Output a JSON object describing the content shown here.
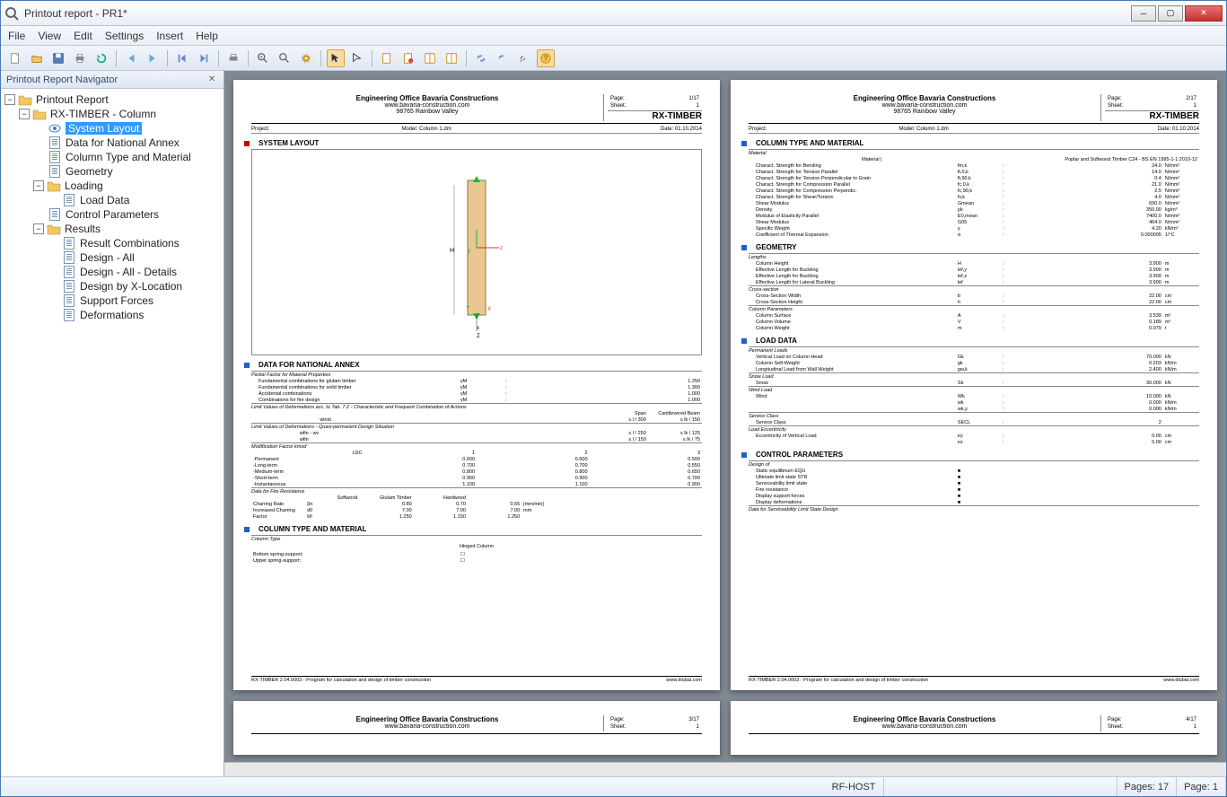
{
  "window": {
    "title": "Printout report - PR1*"
  },
  "menu": {
    "file": "File",
    "view": "View",
    "edit": "Edit",
    "settings": "Settings",
    "insert": "Insert",
    "help": "Help"
  },
  "navigator": {
    "title": "Printout Report Navigator",
    "tree": {
      "root": "Printout Report",
      "module": "RX-TIMBER - Column",
      "items": {
        "system_layout": "System Layout",
        "data_nat_annex": "Data for National Annex",
        "col_type_mat": "Column Type and Material",
        "geometry": "Geometry",
        "loading": "Loading",
        "load_data": "Load Data",
        "control_params": "Control Parameters",
        "results": "Results",
        "result_comb": "Result Combinations",
        "design_all": "Design - All",
        "design_all_details": "Design - All - Details",
        "design_by_x": "Design by X-Location",
        "support_forces": "Support Forces",
        "deformations": "Deformations"
      }
    }
  },
  "report": {
    "company": "Engineering Office Bavaria Constructions",
    "website": "www.bavaria-construction.com",
    "address": "98765 Rainbow Valley",
    "brand": "RX-TIMBER",
    "project_label": "Project:",
    "model_label": "Model:",
    "model_value": "Column 1.dm",
    "date_label": "Date:",
    "date_value": "01.10.2014",
    "page_label": "Page:",
    "sheet_label": "Sheet:",
    "footer_left": "RX-TIMBER 2.04.0003 - Program for calculation and design of timber construction",
    "footer_right": "www.dlubal.com"
  },
  "page1": {
    "page": "1/17",
    "sheet": "1",
    "sections": {
      "system_layout": "SYSTEM LAYOUT",
      "data_annex": "DATA FOR NATIONAL ANNEX",
      "col_type": "COLUMN TYPE AND MATERIAL"
    },
    "annex": {
      "header_partial": "Partial Factor for Material Properties",
      "rows": [
        {
          "lbl": "Fundamental combinations for glulam timber",
          "sym": "γM",
          "val": "1.250"
        },
        {
          "lbl": "Fundamental combinations for solid timber",
          "sym": "γM",
          "val": "1.300"
        },
        {
          "lbl": "Accidental combinations",
          "sym": "γM",
          "val": "1.000"
        },
        {
          "lbl": "Combinations for fire design",
          "sym": "γM",
          "val": "1.000"
        }
      ],
      "limit1_head": "Limit Values of Deformations acc. to Tab. 7.2 - Characteristic and Frequent Combination of Actions",
      "limit1_cols": {
        "span": "Span",
        "cant": "Cantilevered Beam"
      },
      "limit1_rows": [
        {
          "sym": "winst",
          "span": "≤ l / 300",
          "cant": "≤ lk / 150"
        }
      ],
      "limit2_head": "Limit Values of Deformations - Quasi-permanent Design Situation",
      "limit2_rows": [
        {
          "sym": "wfin - wc",
          "span": "≤ l / 250",
          "cant": "≤ lk / 125"
        },
        {
          "sym": "wfin",
          "span": "≤ l / 150",
          "cant": "≤ lk / 75"
        }
      ],
      "kmod_head": "Modification Factor kmod",
      "kmod_cols": [
        "LDC",
        "1",
        "2",
        "3"
      ],
      "kmod_rows": [
        {
          "lbl": "-Permanent",
          "v": [
            "0.600",
            "0.600",
            "0.500"
          ]
        },
        {
          "lbl": "-Long-term",
          "v": [
            "0.700",
            "0.700",
            "0.550"
          ]
        },
        {
          "lbl": "-Medium-term",
          "v": [
            "0.800",
            "0.800",
            "0.650"
          ]
        },
        {
          "lbl": "-Short-term",
          "v": [
            "0.900",
            "0.900",
            "0.700"
          ]
        },
        {
          "lbl": "-Instantaneous",
          "v": [
            "1.100",
            "1.100",
            "0.900"
          ]
        }
      ],
      "fire_head": "Data for Fire Resistance",
      "fire_cols": [
        "",
        "Softwood",
        "Glulam Timber",
        "Hardwood",
        ""
      ],
      "fire_rows": [
        {
          "lbl": "Charring Rate",
          "sym": "βn",
          "v": [
            "0.80",
            "0.70",
            "0.55"
          ],
          "unit": "[mm/min]"
        },
        {
          "lbl": "Increased Charring",
          "sym": "d0",
          "v": [
            "7.00",
            "7.00",
            "7.00"
          ],
          "unit": "mm"
        },
        {
          "lbl": "Factor",
          "sym": "kfi",
          "v": [
            "1.250",
            "1.150",
            "1.250"
          ],
          "unit": ""
        }
      ]
    },
    "coltype": {
      "header": "Column Type",
      "type": "Hinged Column",
      "bottom": "Bottom spring-support:",
      "upper": "Upper spring-support:"
    }
  },
  "page2": {
    "page": "2/17",
    "sheet": "1",
    "sections": {
      "col_type": "COLUMN TYPE AND MATERIAL",
      "geometry": "GEOMETRY",
      "load_data": "LOAD DATA",
      "control_params": "CONTROL PARAMETERS"
    },
    "material": {
      "header": "Material",
      "mat_label": "Material",
      "mat_value": "Poplar and Softwood Timber C24 - BS EN 1995-1-1:2010-12",
      "rows": [
        {
          "lbl": "Charact. Strength for Bending",
          "sym": "fm,k",
          "val": "24.0",
          "unit": "N/mm²"
        },
        {
          "lbl": "Charact. Strength for Tension Parallel",
          "sym": "ft,0,k",
          "val": "14.0",
          "unit": "N/mm²"
        },
        {
          "lbl": "Charact. Strength for Tension Perpendicular to Grain",
          "sym": "ft,90,k",
          "val": "0.4",
          "unit": "N/mm²"
        },
        {
          "lbl": "Charact. Strength for Compression Parallel",
          "sym": "fc,0,k",
          "val": "21.0",
          "unit": "N/mm²"
        },
        {
          "lbl": "Charact. Strength for Compression Perpendic.",
          "sym": "fc,90,k",
          "val": "2.5",
          "unit": "N/mm²"
        },
        {
          "lbl": "Charact. Strength for Shear/Torsion",
          "sym": "fv,k",
          "val": "4.0",
          "unit": "N/mm²"
        },
        {
          "lbl": "Shear Modulus",
          "sym": "Gmean",
          "val": "690.0",
          "unit": "N/mm²"
        },
        {
          "lbl": "Density",
          "sym": "ρk",
          "val": "350.00",
          "unit": "kg/m³"
        },
        {
          "lbl": "Modulus of Elasticity Parallel",
          "sym": "E0,mean",
          "val": "7400.0",
          "unit": "N/mm²"
        },
        {
          "lbl": "Shear Modulus",
          "sym": "G05",
          "val": "464.0",
          "unit": "N/mm²"
        },
        {
          "lbl": "Specific Weight",
          "sym": "γ",
          "val": "4.20",
          "unit": "kN/m³"
        },
        {
          "lbl": "Coefficient of Thermal Expansion",
          "sym": "α",
          "val": "0.000005",
          "unit": "1/°C"
        }
      ]
    },
    "geometry": {
      "lengths_head": "Lengths",
      "lengths": [
        {
          "lbl": "Column Height",
          "sym": "H",
          "val": "3.900",
          "unit": "m"
        },
        {
          "lbl": "Effective Length for Buckling",
          "sym": "lef,y",
          "val": "3.900",
          "unit": "m"
        },
        {
          "lbl": "Effective Length for Buckling",
          "sym": "lef,z",
          "val": "3.900",
          "unit": "m"
        },
        {
          "lbl": "Effective Length for Lateral Buckling",
          "sym": "lef",
          "val": "3.900",
          "unit": "m"
        }
      ],
      "cs_head": "Cross-section",
      "cs": [
        {
          "lbl": "Cross-Section Width",
          "sym": "b",
          "val": "22.00",
          "unit": "cm"
        },
        {
          "lbl": "Cross-Section Height",
          "sym": "h",
          "val": "22.00",
          "unit": "cm"
        }
      ],
      "cp_head": "Column Parameters",
      "cp": [
        {
          "lbl": "Column Surface",
          "sym": "A",
          "val": "3.539",
          "unit": "m²"
        },
        {
          "lbl": "Column Volume",
          "sym": "V",
          "val": "0.189",
          "unit": "m³"
        },
        {
          "lbl": "Column Weight",
          "sym": "m",
          "val": "0.079",
          "unit": "t"
        }
      ]
    },
    "load": {
      "perm_head": "Permanent Loads",
      "perm": [
        {
          "lbl": "Vertical Load on Column Head",
          "sym": "Gk",
          "val": "70.000",
          "unit": "kN"
        },
        {
          "lbl": "Column Self-Weight",
          "sym": "gk",
          "val": "0.203",
          "unit": "kN/m"
        },
        {
          "lbl": "Longitudinal Load from Wall Weight",
          "sym": "gw,k",
          "val": "2.400",
          "unit": "kN/m"
        }
      ],
      "snow_head": "Snow Load",
      "snow": [
        {
          "lbl": "Snow",
          "sym": "Sk",
          "val": "30.000",
          "unit": "kN"
        }
      ],
      "wind_head": "Wind Load",
      "wind": [
        {
          "lbl": "Wind",
          "sym": "Wk",
          "val": "10.000",
          "unit": "kN"
        },
        {
          "lbl": "",
          "sym": "wk",
          "val": "0.000",
          "unit": "kN/m"
        },
        {
          "lbl": "",
          "sym": "wk,y",
          "val": "0.000",
          "unit": "kN/m"
        }
      ],
      "svc_head": "Service Class",
      "svc": [
        {
          "lbl": "Service Class",
          "sym": "SECL",
          "val": "2",
          "unit": ""
        }
      ],
      "ecc_head": "Load Eccentricity",
      "ecc": [
        {
          "lbl": "Eccentricity of Vertical Load",
          "sym": "ey",
          "val": "0.00",
          "unit": "cm"
        },
        {
          "lbl": "",
          "sym": "ez",
          "val": "5.00",
          "unit": "cm"
        }
      ]
    },
    "control": {
      "head": "Design of",
      "rows": [
        "Static equilibrium EQU",
        "Ultimate limit state STR",
        "Serviceability limit state",
        "Fire resistance",
        "Display support forces",
        "Display deformations"
      ],
      "foot": "Data for Serviceability Limit State Design"
    }
  },
  "page3": {
    "page": "3/17",
    "sheet": "1"
  },
  "page4": {
    "page": "4/17",
    "sheet": "1"
  },
  "status": {
    "host": "RF-HOST",
    "pages": "Pages: 17",
    "page": "Page: 1"
  }
}
